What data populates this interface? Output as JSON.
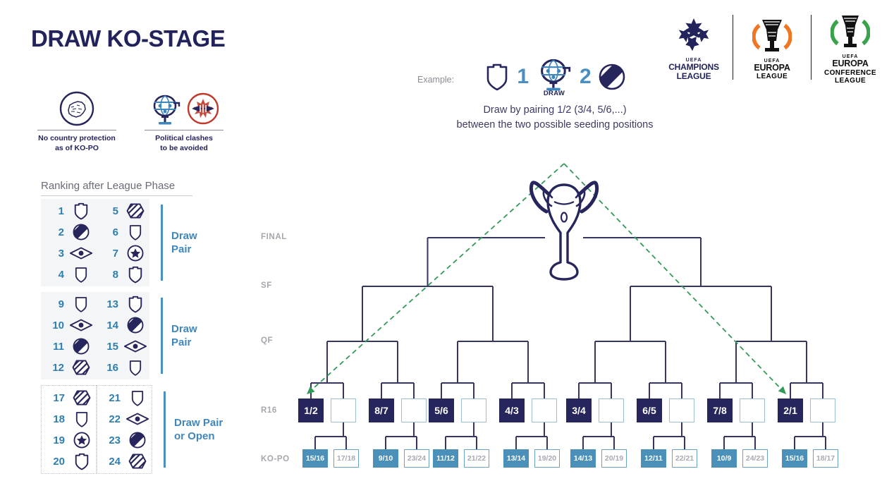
{
  "page": {
    "title": "DRAW KO-STAGE",
    "accent_navy": "#26265c",
    "accent_blue": "#4a8fc0",
    "accent_steel": "#4a90b8",
    "accent_green": "#349a5a"
  },
  "legend": {
    "items": [
      {
        "icon": "europe-map-icon",
        "caption_line1": "No country protection",
        "caption_line2": "as of KO-PO"
      },
      {
        "icon": "draw-globe-icon",
        "icon2": "political-clash-icon",
        "caption_line1": "Political clashes",
        "caption_line2": "to be avoided"
      }
    ]
  },
  "example": {
    "label": "Example:",
    "left_crest": "shield-notched-icon",
    "left_number": "1",
    "draw_icon": "draw-globe-icon",
    "draw_caption": "DRAW",
    "right_number": "2",
    "right_crest": "circle-band-icon",
    "description_line1": "Draw by pairing 1/2 (3/4, 5/6,...)",
    "description_line2": "between the two possible seeding positions"
  },
  "logos": [
    {
      "id": "champions-league",
      "uefa": "UEFA",
      "name": "CHAMPIONS",
      "sub": "LEAGUE",
      "tm": "®",
      "color": "#23235c"
    },
    {
      "id": "europa-league",
      "uefa": "UEFA",
      "name": "EUROPA",
      "sub": "LEAGUE",
      "tm": "™",
      "color": "#111111",
      "ring": "#ef7622"
    },
    {
      "id": "europa-conference-league",
      "uefa": "UEFA",
      "name": "EUROPA",
      "sub": "CONFERENCE",
      "sub2": "LEAGUE",
      "tm": "™",
      "color": "#111111",
      "ring": "#38a34a"
    }
  ],
  "ranking": {
    "heading": "Ranking after League Phase",
    "groups": [
      {
        "label_line1": "Draw",
        "label_line2": "Pair",
        "style": "solid",
        "col_left": [
          {
            "n": "1",
            "crest": "shield-notched-icon"
          },
          {
            "n": "2",
            "crest": "circle-band-icon"
          },
          {
            "n": "3",
            "crest": "diamond-dot-icon"
          },
          {
            "n": "4",
            "crest": "shield-plain-icon"
          }
        ],
        "col_right": [
          {
            "n": "5",
            "crest": "hex-stripes-icon"
          },
          {
            "n": "6",
            "crest": "shield-plain-icon"
          },
          {
            "n": "7",
            "crest": "circle-star-icon"
          },
          {
            "n": "8",
            "crest": "shield-notched-icon"
          }
        ]
      },
      {
        "label_line1": "Draw",
        "label_line2": "Pair",
        "style": "solid",
        "col_left": [
          {
            "n": "9",
            "crest": "shield-plain-icon"
          },
          {
            "n": "10",
            "crest": "diamond-dot-icon"
          },
          {
            "n": "11",
            "crest": "circle-band-icon"
          },
          {
            "n": "12",
            "crest": "hex-stripes-icon"
          }
        ],
        "col_right": [
          {
            "n": "13",
            "crest": "shield-notched-icon"
          },
          {
            "n": "14",
            "crest": "circle-band-icon"
          },
          {
            "n": "15",
            "crest": "diamond-dot-icon"
          },
          {
            "n": "16",
            "crest": "shield-plain-icon"
          }
        ]
      },
      {
        "label_line1": "Draw Pair",
        "label_line2": "or Open",
        "style": "dotted",
        "col_left": [
          {
            "n": "17",
            "crest": "hex-stripes-icon"
          },
          {
            "n": "18",
            "crest": "shield-plain-icon"
          },
          {
            "n": "19",
            "crest": "circle-star-icon"
          },
          {
            "n": "20",
            "crest": "shield-notched-icon"
          }
        ],
        "col_right": [
          {
            "n": "21",
            "crest": "shield-plain-icon"
          },
          {
            "n": "22",
            "crest": "diamond-dot-icon"
          },
          {
            "n": "23",
            "crest": "circle-band-icon"
          },
          {
            "n": "24",
            "crest": "hex-stripes-icon"
          }
        ]
      }
    ]
  },
  "bracket": {
    "stages": [
      {
        "id": "final",
        "label": "FINAL"
      },
      {
        "id": "sf",
        "label": "SF"
      },
      {
        "id": "qf",
        "label": "QF"
      },
      {
        "id": "r16",
        "label": "R16"
      },
      {
        "id": "kopo",
        "label": "KO-PO"
      }
    ],
    "trophy_icon": "ucl-trophy-icon",
    "r16_seeds": [
      "1/2",
      "8/7",
      "5/6",
      "4/3",
      "3/4",
      "6/5",
      "7/8",
      "2/1"
    ],
    "kopo_pairs": [
      {
        "seeded": "15/16",
        "open": "17/18"
      },
      {
        "seeded": "9/10",
        "open": "23/24"
      },
      {
        "seeded": "11/12",
        "open": "21/22"
      },
      {
        "seeded": "13/14",
        "open": "19/20"
      },
      {
        "seeded": "14/13",
        "open": "20/19"
      },
      {
        "seeded": "12/11",
        "open": "22/21"
      },
      {
        "seeded": "10/9",
        "open": "24/23"
      },
      {
        "seeded": "15/16",
        "open": "18/17"
      }
    ]
  }
}
